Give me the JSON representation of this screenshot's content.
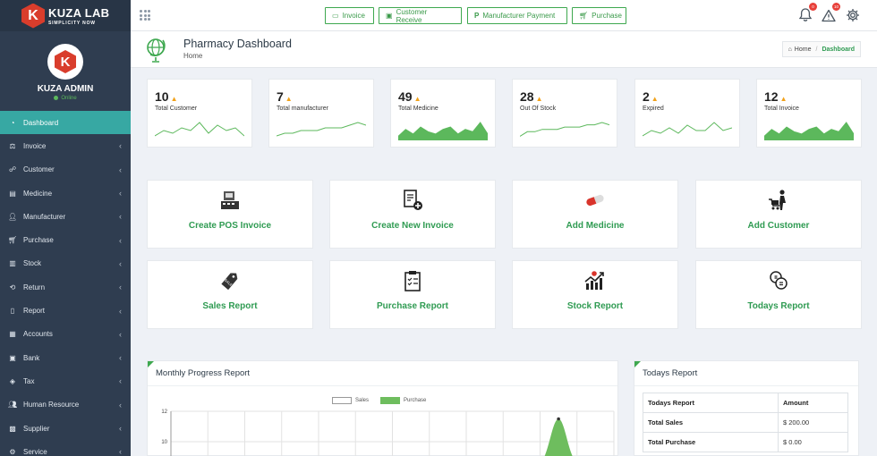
{
  "brand": {
    "name": "KUZA LAB",
    "tagline": "SIMPLICITY NOW",
    "logo_letter": "K"
  },
  "user": {
    "name": "KUZA ADMIN",
    "status": "Online"
  },
  "sidebar": {
    "items": [
      {
        "label": "Dashboard",
        "icon": "dashboard-icon",
        "active": true
      },
      {
        "label": "Invoice",
        "icon": "scale-icon"
      },
      {
        "label": "Customer",
        "icon": "handshake-icon"
      },
      {
        "label": "Medicine",
        "icon": "briefcase-icon"
      },
      {
        "label": "Manufacturer",
        "icon": "user-icon"
      },
      {
        "label": "Purchase",
        "icon": "cart-icon"
      },
      {
        "label": "Stock",
        "icon": "box-icon"
      },
      {
        "label": "Return",
        "icon": "return-icon"
      },
      {
        "label": "Report",
        "icon": "report-icon"
      },
      {
        "label": "Accounts",
        "icon": "accounts-icon"
      },
      {
        "label": "Bank",
        "icon": "bank-icon"
      },
      {
        "label": "Tax",
        "icon": "tag-icon"
      },
      {
        "label": "Human Resource",
        "icon": "users-icon"
      },
      {
        "label": "Supplier",
        "icon": "supplier-icon"
      },
      {
        "label": "Service",
        "icon": "service-icon"
      }
    ]
  },
  "header": {
    "quick_buttons": [
      {
        "label": "Invoice",
        "icon": "invoice-icon"
      },
      {
        "label": "Customer Receive",
        "icon": "money-icon"
      },
      {
        "label": "Manufacturer Payment",
        "icon": "paypal-icon"
      },
      {
        "label": "Purchase",
        "icon": "cart-icon"
      }
    ],
    "notifications_count": "0",
    "alerts_count": "10"
  },
  "page": {
    "title": "Pharmacy Dashboard",
    "subtitle": "Home",
    "breadcrumb_home": "Home",
    "breadcrumb_current": "Dashboard"
  },
  "stats": [
    {
      "value": "10",
      "label": "Total Customer",
      "spark_type": "line",
      "spark": [
        3,
        5,
        4,
        6,
        5,
        8,
        4,
        7,
        5,
        6,
        3
      ]
    },
    {
      "value": "7",
      "label": "Total manufacturer",
      "spark_type": "line",
      "spark": [
        3,
        4,
        4,
        5,
        5,
        5,
        6,
        6,
        6,
        7,
        8,
        7
      ]
    },
    {
      "value": "49",
      "label": "Total Medicine",
      "spark_type": "area",
      "spark": [
        2,
        5,
        3,
        6,
        4,
        3,
        5,
        6,
        3,
        5,
        4,
        8,
        3
      ]
    },
    {
      "value": "28",
      "label": "Out Of Stock",
      "spark_type": "line",
      "spark": [
        3,
        5,
        5,
        6,
        6,
        6,
        7,
        7,
        7,
        8,
        8,
        9,
        8
      ]
    },
    {
      "value": "2",
      "label": "Expired",
      "spark_type": "line",
      "spark": [
        3,
        5,
        4,
        6,
        4,
        7,
        5,
        5,
        8,
        5,
        6
      ]
    },
    {
      "value": "12",
      "label": "Total Invoice",
      "spark_type": "area",
      "spark": [
        2,
        5,
        3,
        6,
        4,
        3,
        5,
        6,
        3,
        5,
        4,
        8,
        3
      ]
    }
  ],
  "actions": [
    {
      "label": "Create POS Invoice",
      "icon": "pos-terminal-icon"
    },
    {
      "label": "Create New Invoice",
      "icon": "new-invoice-icon"
    },
    {
      "label": "Add Medicine",
      "icon": "pill-icon"
    },
    {
      "label": "Add Customer",
      "icon": "shopping-customer-icon"
    },
    {
      "label": "Sales Report",
      "icon": "sale-tag-icon"
    },
    {
      "label": "Purchase Report",
      "icon": "clipboard-icon"
    },
    {
      "label": "Stock Report",
      "icon": "stock-chart-icon"
    },
    {
      "label": "Todays Report",
      "icon": "coins-icon"
    }
  ],
  "monthly_panel": {
    "title": "Monthly Progress Report"
  },
  "chart_data": {
    "type": "area",
    "title": "Monthly Progress Report",
    "series": [
      {
        "name": "Sales",
        "color": "#ffffff"
      },
      {
        "name": "Purchase",
        "color": "#6ebd5e"
      }
    ],
    "y_ticks": [
      "12",
      "10"
    ],
    "peak": {
      "x_index": 10,
      "value": 11.5
    }
  },
  "todays_report": {
    "title": "Todays Report",
    "headers": [
      "Todays Report",
      "Amount"
    ],
    "rows": [
      {
        "label": "Total Sales",
        "amount": "$ 200.00"
      },
      {
        "label": "Total Purchase",
        "amount": "$ 0.00"
      }
    ]
  },
  "colors": {
    "sidebar": "#2f3d50",
    "active": "#37a8a3",
    "accent": "#2f9b52",
    "brand": "#d93d2c",
    "spark": "#5cb85c"
  }
}
